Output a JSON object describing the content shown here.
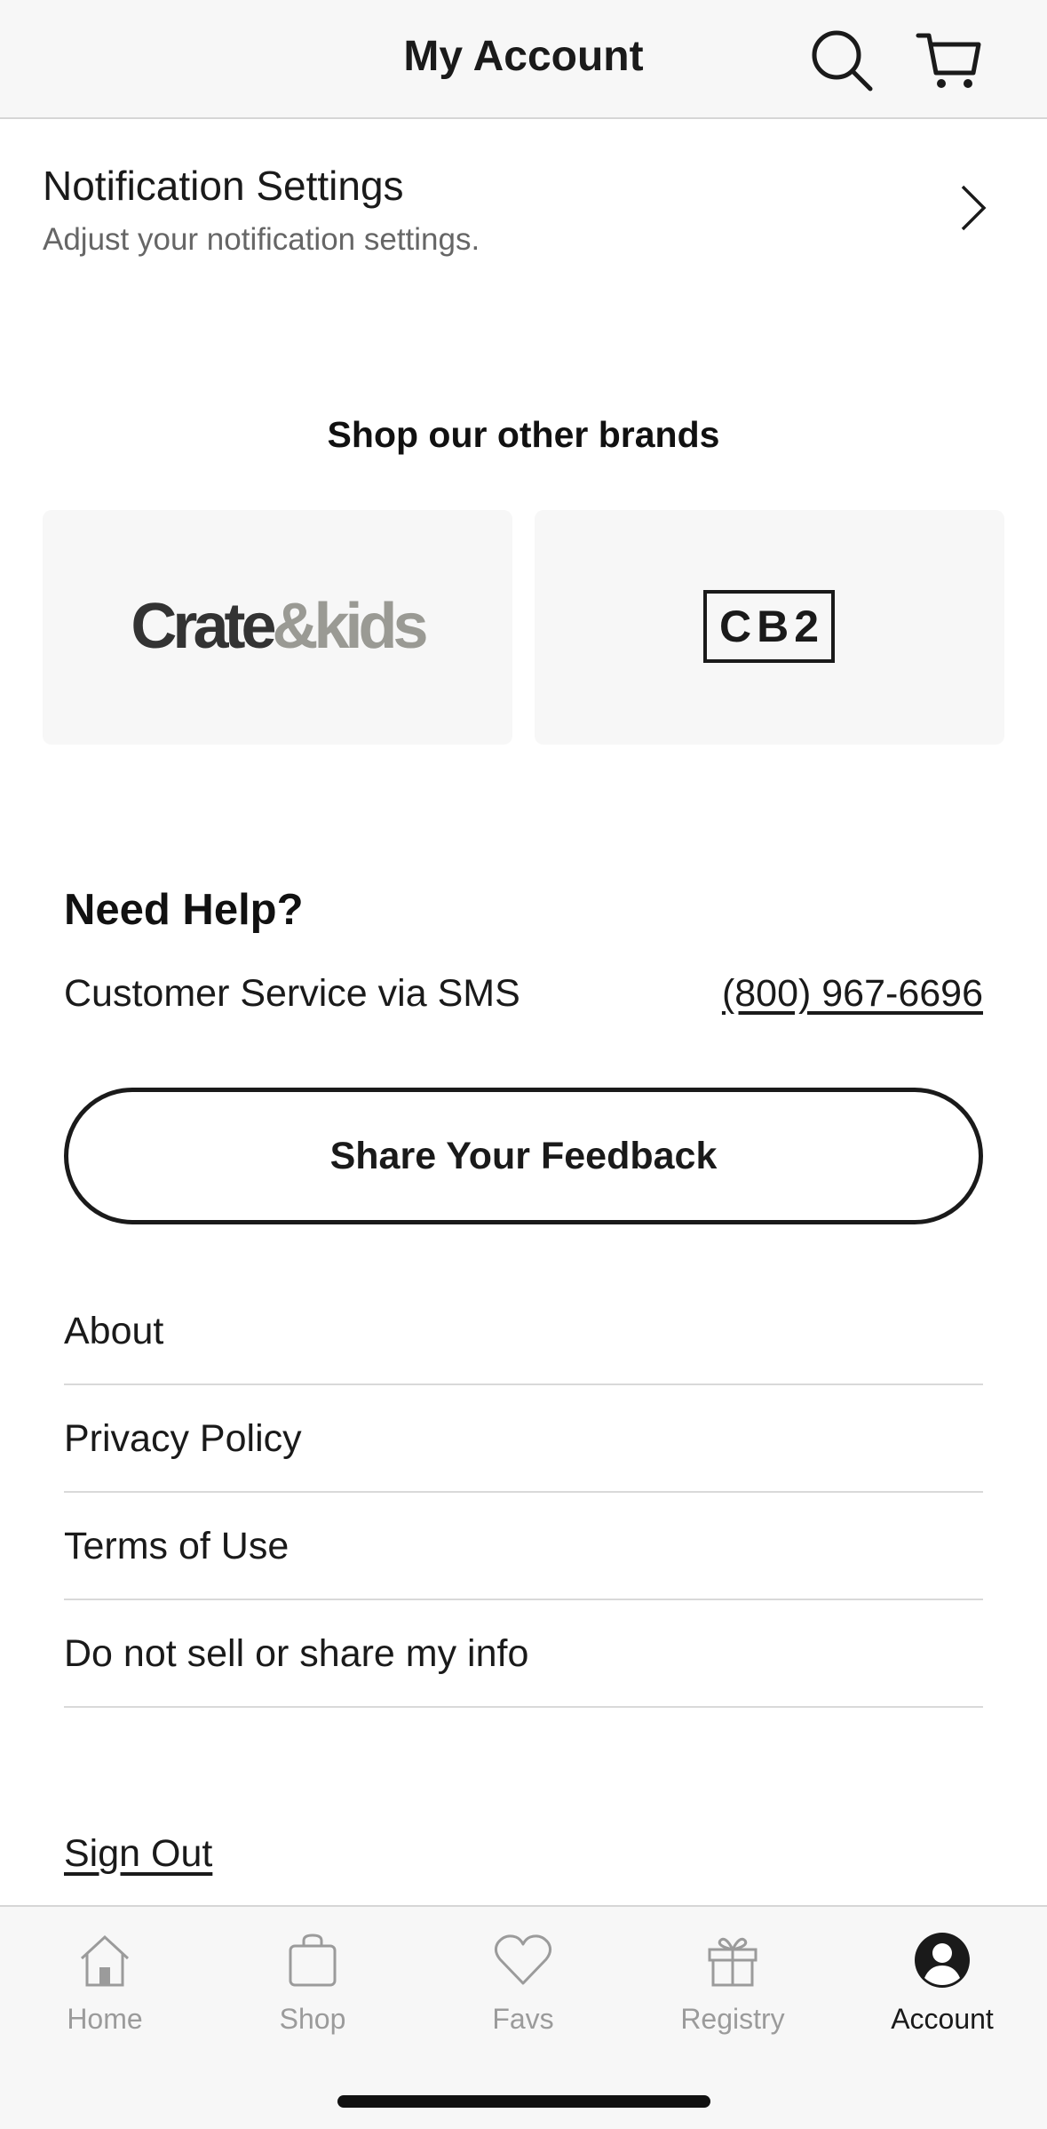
{
  "header": {
    "title": "My Account",
    "search_icon": "search-icon",
    "cart_icon": "cart-icon"
  },
  "notification_settings": {
    "title": "Notification Settings",
    "subtitle": "Adjust your notification settings."
  },
  "brands": {
    "heading": "Shop our other brands",
    "items": [
      {
        "logo_part1": "Crate",
        "logo_part2": "&kids"
      },
      {
        "logo": "CB2"
      }
    ]
  },
  "help": {
    "title": "Need Help?",
    "sms_label": "Customer Service via SMS",
    "phone": "(800) 967-6696",
    "feedback_button": "Share Your Feedback"
  },
  "links": [
    {
      "label": "About"
    },
    {
      "label": "Privacy Policy"
    },
    {
      "label": "Terms of Use"
    },
    {
      "label": "Do not sell or share my info"
    }
  ],
  "sign_out": "Sign Out",
  "tabbar": {
    "tabs": [
      {
        "label": "Home",
        "icon": "home-icon"
      },
      {
        "label": "Shop",
        "icon": "shopping-bag-icon"
      },
      {
        "label": "Favs",
        "icon": "heart-icon"
      },
      {
        "label": "Registry",
        "icon": "gift-icon"
      },
      {
        "label": "Account",
        "icon": "account-icon"
      }
    ],
    "active": "Account"
  },
  "colors": {
    "text": "#1a1a1a",
    "muted": "#666666",
    "tab_inactive": "#9b9b9b",
    "card_bg": "#f7f7f7",
    "kids_gray": "#9a9a94"
  }
}
